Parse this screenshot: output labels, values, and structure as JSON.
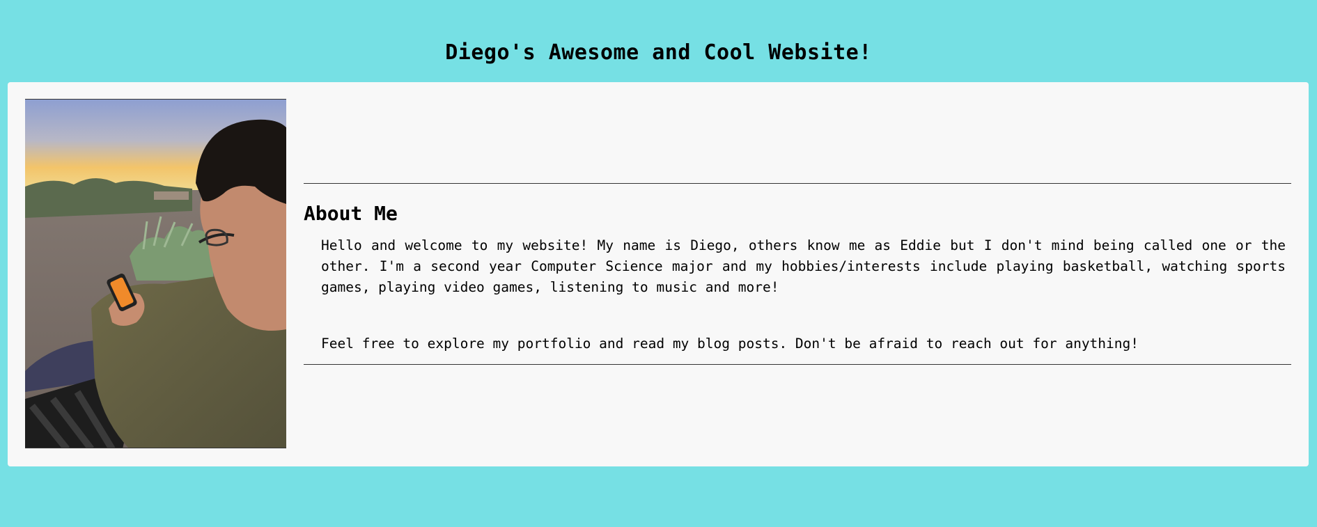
{
  "header": {
    "title": "Diego's Awesome and Cool Website!"
  },
  "about": {
    "heading": "About Me",
    "paragraphs": [
      "Hello and welcome to my website! My name is Diego, others know me as Eddie but I don't mind being called one or the other. I'm a second year Computer Science major and my hobbies/interests include playing basketball, watching sports games, playing video games, listening to music and more!",
      "Feel free to explore my portfolio and read my blog posts. Don't be afraid to reach out for anything!"
    ]
  },
  "colors": {
    "page_background": "#76e0e4",
    "card_background": "#f8f8f8"
  }
}
